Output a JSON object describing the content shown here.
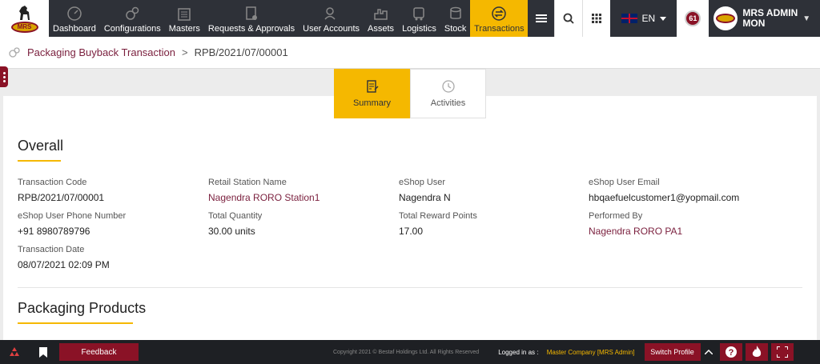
{
  "nav": {
    "items": [
      {
        "label": "Dashboard",
        "icon": "dashboard-icon"
      },
      {
        "label": "Configurations",
        "icon": "gears-icon"
      },
      {
        "label": "Masters",
        "icon": "masters-icon"
      },
      {
        "label": "Requests & Approvals",
        "icon": "requests-icon"
      },
      {
        "label": "User Accounts",
        "icon": "user-accounts-icon"
      },
      {
        "label": "Assets",
        "icon": "assets-icon"
      },
      {
        "label": "Logistics",
        "icon": "logistics-icon"
      },
      {
        "label": "Stock",
        "icon": "stock-icon"
      },
      {
        "label": "Transactions",
        "icon": "transactions-icon"
      }
    ],
    "active": "Transactions",
    "logo_text": "MRS"
  },
  "toolbar": {
    "language": "EN",
    "notification_count": "61",
    "user_name": "MRS ADMIN",
    "user_sub": "MON"
  },
  "breadcrumb": {
    "parent": "Packaging Buyback Transaction",
    "separator": ">",
    "current": "RPB/2021/07/00001"
  },
  "tabs": [
    {
      "label": "Summary"
    },
    {
      "label": "Activities"
    }
  ],
  "overall": {
    "title": "Overall",
    "fields": [
      {
        "label": "Transaction Code",
        "value": "RPB/2021/07/00001"
      },
      {
        "label": "Retail Station Name",
        "value": "Nagendra RORO Station1"
      },
      {
        "label": "eShop User",
        "value": "Nagendra N"
      },
      {
        "label": "eShop User Email",
        "value": "hbqaefuelcustomer1@yopmail.com"
      },
      {
        "label": "eShop User Phone Number",
        "value": "+91 8980789796"
      },
      {
        "label": "Total Quantity",
        "value": "30.00 units"
      },
      {
        "label": "Total Reward Points",
        "value": "17.00"
      },
      {
        "label": "Performed By",
        "value": "Nagendra RORO PA1"
      },
      {
        "label": "Transaction Date",
        "value": "08/07/2021 02:09 PM"
      }
    ]
  },
  "products": {
    "title": "Packaging Products"
  },
  "footer": {
    "feedback": "Feedback",
    "copyright": "Copyright 2021 © Bestaf Holdings Ltd. All Rights Reserved",
    "logged_in_label": "Logged in as :",
    "logged_in_value": "Master Company [MRS Admin]",
    "switch_profile": "Switch Profile"
  },
  "colors": {
    "brand": "#8a1226",
    "accent": "#f5b800",
    "nav_bg": "#2e3138"
  }
}
